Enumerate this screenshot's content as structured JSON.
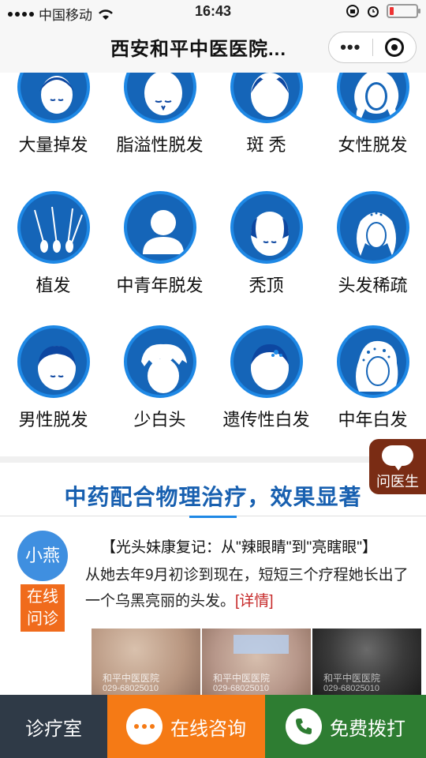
{
  "status_bar": {
    "carrier": "中国移动",
    "time": "16:43"
  },
  "title_bar": {
    "title": "西安和平中医医院...",
    "more_label": "•••"
  },
  "categories": [
    {
      "label": "大量掉发",
      "icon": "woman-head-icon"
    },
    {
      "label": "脂溢性脱发",
      "icon": "bald-head-icon"
    },
    {
      "label": "斑 秃",
      "icon": "patchy-head-icon"
    },
    {
      "label": "女性脱发",
      "icon": "woman-hair-icon"
    },
    {
      "label": "植发",
      "icon": "hair-follicle-icon"
    },
    {
      "label": "中青年脱发",
      "icon": "person-icon"
    },
    {
      "label": "秃顶",
      "icon": "bald-top-icon"
    },
    {
      "label": "头发稀疏",
      "icon": "thin-hair-woman-icon"
    },
    {
      "label": "男性脱发",
      "icon": "man-head-icon"
    },
    {
      "label": "少白头",
      "icon": "white-hair-icon"
    },
    {
      "label": "遗传性白发",
      "icon": "spotted-head-icon"
    },
    {
      "label": "中年白发",
      "icon": "gray-hair-woman-icon"
    }
  ],
  "headline": "中药配合物理治疗，效果显著",
  "article": {
    "avatar_name": "小燕",
    "consult_line1": "在线",
    "consult_line2": "问诊",
    "title": "【光头妹康复记：从\"辣眼睛\"到\"亮瞎眼\"】",
    "body": "从她去年9月初诊到现在，短短三个疗程她长出了一个乌黑亮丽的头发。",
    "more": "[详情]"
  },
  "photo_watermark": "和平中医医院",
  "photo_phone": "029-68025010",
  "float_button": "问医生",
  "bottom_bar": {
    "clinic": "诊疗室",
    "online": "在线咨询",
    "call": "免费拨打"
  },
  "colors": {
    "primary_blue": "#1565b8",
    "ring_blue": "#1e88e5",
    "headline_blue": "#1860b0",
    "orange": "#f57a15",
    "green": "#2e7d32",
    "dark": "#2f3a47"
  }
}
